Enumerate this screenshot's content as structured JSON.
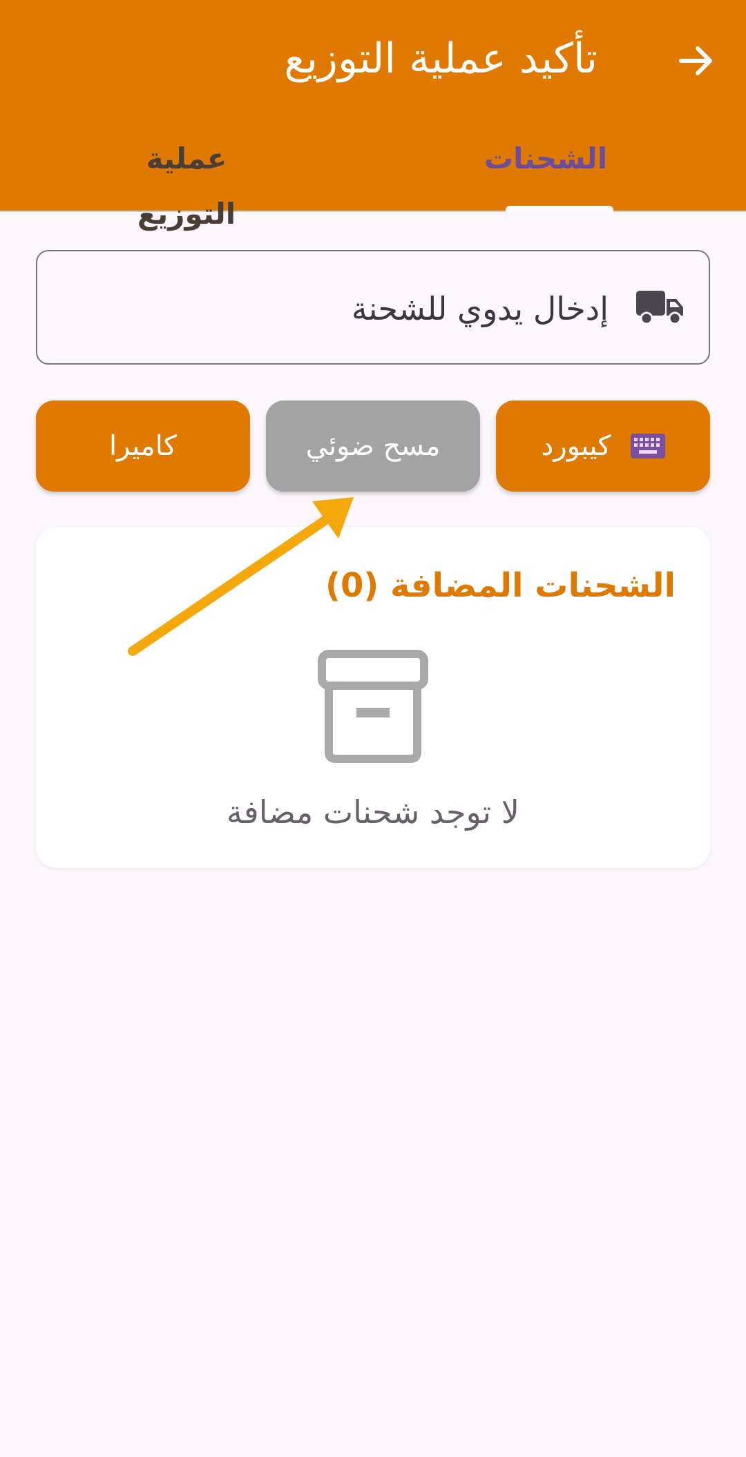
{
  "app_bar": {
    "title": "تأكيد عملية التوزيع",
    "back_icon": "arrow-forward-icon",
    "background": "#df7900"
  },
  "tabs": [
    {
      "label": "الشحنات",
      "selected": true,
      "color": "#6d4c9e"
    },
    {
      "label": "عملية التوزيع",
      "selected": false
    }
  ],
  "manual_entry": {
    "placeholder": "إدخال يدوي للشحنة",
    "icon": "truck-icon"
  },
  "input_modes": [
    {
      "label": "كيبورد",
      "icon": "keyboard-icon",
      "state": "active"
    },
    {
      "label": "مسح ضوئي",
      "state": "disabled"
    },
    {
      "label": "كاميرا",
      "state": "active"
    }
  ],
  "added_shipments": {
    "title": "الشحنات المضافة (0)",
    "empty_icon": "archive-box-icon",
    "empty_message": "لا توجد شحنات مضافة"
  },
  "colors": {
    "accent": "#df7900",
    "disabled_button": "#a3a3a3",
    "annotation_arrow": "#f5a80c",
    "page_background": "#fdf7fd"
  }
}
